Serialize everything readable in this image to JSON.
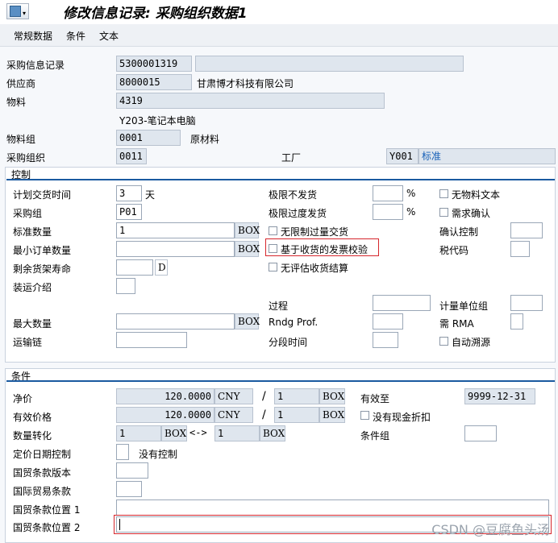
{
  "window": {
    "title": "修改信息记录: 采购组织数据1"
  },
  "toolbar": {
    "general_data": "常规数据",
    "conditions": "条件",
    "text": "文本"
  },
  "header": {
    "info_record_label": "采购信息记录",
    "info_record_value": "5300001319",
    "vendor_label": "供应商",
    "vendor_value": "8000015",
    "vendor_name": "甘肃博才科技有限公司",
    "material_label": "物料",
    "material_value": "4319",
    "material_desc": "Y203-笔记本电脑",
    "material_group_label": "物料组",
    "material_group_value": "0001",
    "material_group_desc": "原材料",
    "purch_org_label": "采购组织",
    "purch_org_value": "0011",
    "plant_label": "工厂",
    "plant_value": "Y001",
    "plant_desc": "标准"
  },
  "control": {
    "section_title": "控制",
    "planned_delivery_label": "计划交货时间",
    "planned_delivery_value": "3",
    "planned_delivery_unit": "天",
    "purch_group_label": "采购组",
    "purch_group_value": "P01",
    "standard_qty_label": "标准数量",
    "standard_qty_value": "1",
    "standard_qty_unit": "BOX",
    "min_order_label": "最小订单数量",
    "min_order_unit": "BOX",
    "shelf_life_label": "剩余货架寿命",
    "shelf_life_unit": "D",
    "shipping_label": "装运介绍",
    "under_tol_label": "极限不发货",
    "under_tol_pct": "%",
    "over_tol_label": "极限过度发货",
    "over_tol_pct": "%",
    "unlimited_label": "无限制过量交货",
    "gr_iv_label": "基于收货的发票校验",
    "no_eval_label": "无评估收货结算",
    "no_mat_text_label": "无物料文本",
    "ack_required_label": "需求确认",
    "confirm_ctrl_label": "确认控制",
    "tax_code_label": "税代码",
    "procedure_label": "过程",
    "max_qty_label": "最大数量",
    "max_qty_unit": "BOX",
    "rndg_label": "Rndg Prof.",
    "unit_group_label": "计量单位组",
    "rma_label": "需 RMA",
    "transport_label": "运输链",
    "staging_label": "分段时间",
    "auto_source_label": "自动溯源"
  },
  "conditions": {
    "section_title": "条件",
    "net_price_label": "净价",
    "net_price_value": "120.0000",
    "net_price_curr": "CNY",
    "net_price_per": "1",
    "net_price_unit": "BOX",
    "valid_to_label": "有效至",
    "valid_to_value": "9999-12-31",
    "eff_price_label": "有效价格",
    "eff_price_value": "120.0000",
    "eff_price_curr": "CNY",
    "eff_price_per": "1",
    "eff_price_unit": "BOX",
    "no_cash_disc_label": "没有现金折扣",
    "qty_conv_label": "数量转化",
    "qty_conv_from": "1",
    "qty_conv_from_unit": "BOX",
    "qty_conv_arrow": "<->",
    "qty_conv_to": "1",
    "qty_conv_to_unit": "BOX",
    "cond_group_label": "条件组",
    "pricing_date_label": "定价日期控制",
    "pricing_date_value": "没有控制",
    "incoterms_ver_label": "国贸条款版本",
    "incoterms_label": "国际贸易条款",
    "incoterms_loc1_label": "国贸条款位置 1",
    "incoterms_loc2_label": "国贸条款位置 2",
    "slash": "/"
  },
  "watermark": "CSDN @豆腐鱼头汤",
  "colors": {
    "accent_line": "#1a5aa0",
    "highlight_box": "#d6262c",
    "readonly_field": "#dfe6ee"
  }
}
